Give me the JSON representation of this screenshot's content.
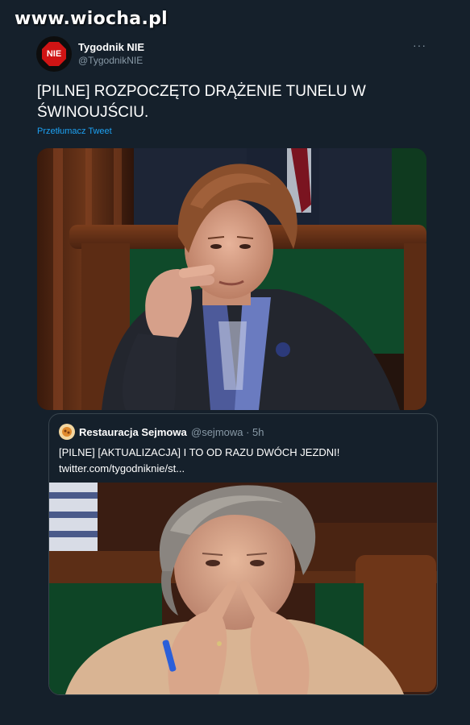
{
  "watermark": "www.wiocha.pl",
  "tweet": {
    "avatar_text": "NIE",
    "author_name": "Tygodnik NIE",
    "author_handle": "@TygodnikNIE",
    "more_icon": "···",
    "text_line1": "[PILNE] ROZPOCZĘTO DRĄŻENIE TUNELU W",
    "text_line2": "ŚWINOUJŚCIU.",
    "translate_link": "Przetłumacz Tweet"
  },
  "quote": {
    "author_name": "Restauracja Sejmowa",
    "meta": "@sejmowa · 5h",
    "text_line1": "[PILNE] [AKTUALIZACJA] I TO OD RAZU DWÓCH JEZDNI!",
    "text_line2": "twitter.com/tygodniknie/st..."
  },
  "icons": {
    "avatar": "stop-sign-icon",
    "more": "more-options-icon",
    "quote_avatar": "food-icon"
  },
  "colors": {
    "background": "#15202b",
    "link": "#1da1f2",
    "secondary_text": "#8899a6",
    "border": "#38444d",
    "logo_red": "#d01414"
  }
}
